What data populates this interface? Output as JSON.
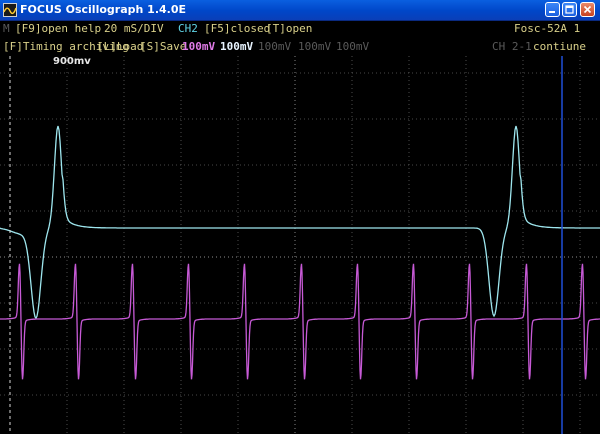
{
  "window": {
    "title": "FOCUS Oscillograph 1.4.0E",
    "icon": "app-icon",
    "controls": [
      "minimize-icon",
      "maximize-icon",
      "close-icon"
    ]
  },
  "menu_row1": {
    "m_label": "M",
    "help": "[F9]open help",
    "timebase": "20 mS/DIV",
    "channel": "CH2",
    "closed": "[F5]closed",
    "open": "[T]open",
    "device": "Fosc-52A 1"
  },
  "menu_row2": {
    "timing": "[F]Timing archiving",
    "load": "[L]Load",
    "save": "[S]Save",
    "ch1_volts": "100mV",
    "ch2_volts": "100mV",
    "ch3_volts": "100mV",
    "ch4_volts": "100mV",
    "ch5_volts": "100mV",
    "channel_diff": "CH 2-1",
    "continue": "contiune"
  },
  "scope": {
    "marker_label": "900mv",
    "colors": {
      "background": "#000000",
      "grid": "#5f5f5f",
      "trace_ch1": "#9ee6ee",
      "trace_ch2": "#c75ad6",
      "cursor": "#1f4fd8"
    },
    "divisions": {
      "x": 10,
      "y": 8
    }
  }
}
